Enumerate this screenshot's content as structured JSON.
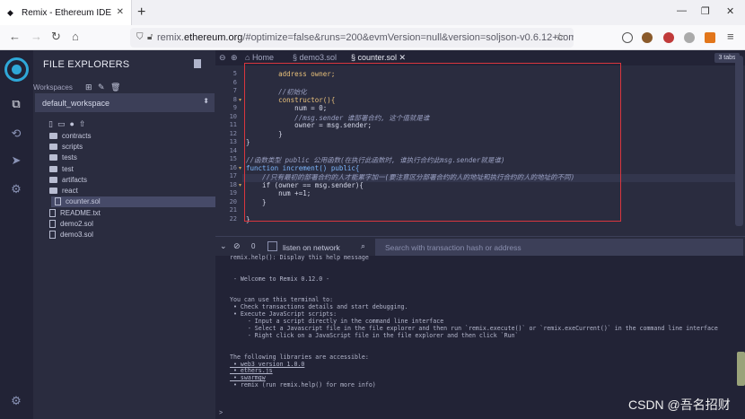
{
  "browser": {
    "tab_title": "Remix - Ethereum IDE",
    "tab_close": "✕",
    "new_tab": "+",
    "url_prefix": "remix.",
    "url_domain": "ethereum.org",
    "url_rest": "/#optimize=false&runs=200&evmVersion=null&version=soljson-v0.6.12+com"
  },
  "sidepanel": {
    "title": "FILE EXPLORERS",
    "workspaces_label": "Workspaces",
    "workspace_selected": "default_workspace",
    "tree": [
      "contracts",
      "scripts",
      "tests",
      "test",
      "artifacts",
      "react",
      "counter.sol",
      "README.txt",
      "demo2.sol",
      "demo3.sol"
    ]
  },
  "editor": {
    "tabs": [
      "Home",
      "demo3.sol",
      "counter.sol"
    ],
    "tabs_button": "3 tabs",
    "line_numbers": [
      "5",
      "6",
      "7",
      "8",
      "9",
      "10",
      "11",
      "12",
      "13",
      "14",
      "15",
      "16",
      "17",
      "18",
      "19",
      "20",
      "21",
      "22"
    ],
    "code": [
      "        address owner;",
      "",
      "        //初始化",
      "        constructor(){",
      "            num = 0;",
      "            //msg.sender 谁部署合约, 这个值就是谁",
      "            owner = msg.sender;",
      "        }",
      "}",
      "",
      "//函数类型 public 公用函数(在执行此函数时, 谁执行合约此msg.sender就是谁)",
      "function increment() public{",
      "    //只有最初的部署合约的人才能累字加一(要注意区分部署合约的人的地址和执行合约的人的地址的不同)",
      "    if (owner == msg.sender){",
      "        num +=1;",
      "    }",
      "",
      "}"
    ]
  },
  "terminal": {
    "count": "0",
    "listen_label": "listen on network",
    "search_placeholder": "Search with transaction hash or address",
    "lines": [
      "remix.help(): Display this help message",
      "",
      "",
      " - Welcome to Remix 0.12.0 -",
      "",
      "",
      "You can use this terminal to:",
      " • Check transactions details and start debugging.",
      " • Execute JavaScript scripts:",
      "     - Input a script directly in the command line interface",
      "     - Select a Javascript file in the file explorer and then run `remix.execute()` or `remix.exeCurrent()` in the command line interface",
      "     - Right click on a JavaScript file in the file explorer and then click `Run`",
      "",
      "",
      "The following libraries are accessible:",
      " • web3 version 1.0.0",
      " • ethers.js",
      " • swarmgw",
      " • remix (run remix.help() for more info)"
    ]
  },
  "watermark": "CSDN @吾名招财",
  "colors": {
    "highlight_box": "#d9363e",
    "accent": "#2fa8d8"
  }
}
